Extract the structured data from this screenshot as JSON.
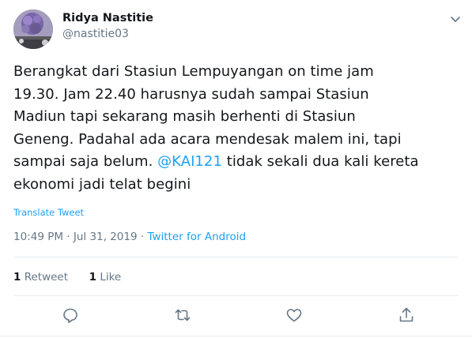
{
  "user": {
    "display_name": "Ridya Nastitie",
    "handle": "@nastitie03",
    "avatar_icon": "flower-photo-avatar"
  },
  "tweet": {
    "text_before_mention": "Berangkat dari Stasiun Lempuyangan on time jam\n19.30. Jam 22.40 harusnya sudah sampai Stasiun\nMadiun tapi sekarang masih berhenti di Stasiun\nGeneng. Padahal ada acara mendesak malem ini, tapi\nsampai saja belum. ",
    "mention": "@KAI121",
    "text_after_mention": " tidak sekali dua kali kereta\nekonomi jadi telat begini",
    "translate_label": "Translate Tweet",
    "time": "10:49 PM",
    "date": "Jul 31, 2019",
    "separator": " · ",
    "source": "Twitter for Android"
  },
  "stats": {
    "retweets_count": "1",
    "retweets_label": "Retweet",
    "likes_count": "1",
    "likes_label": "Like"
  },
  "actions": [
    "reply-icon",
    "retweet-icon",
    "like-icon",
    "share-icon"
  ],
  "colors": {
    "accent": "#1da1f2",
    "text": "#14171a",
    "secondary": "#657786",
    "divider": "#e6ecf0"
  }
}
